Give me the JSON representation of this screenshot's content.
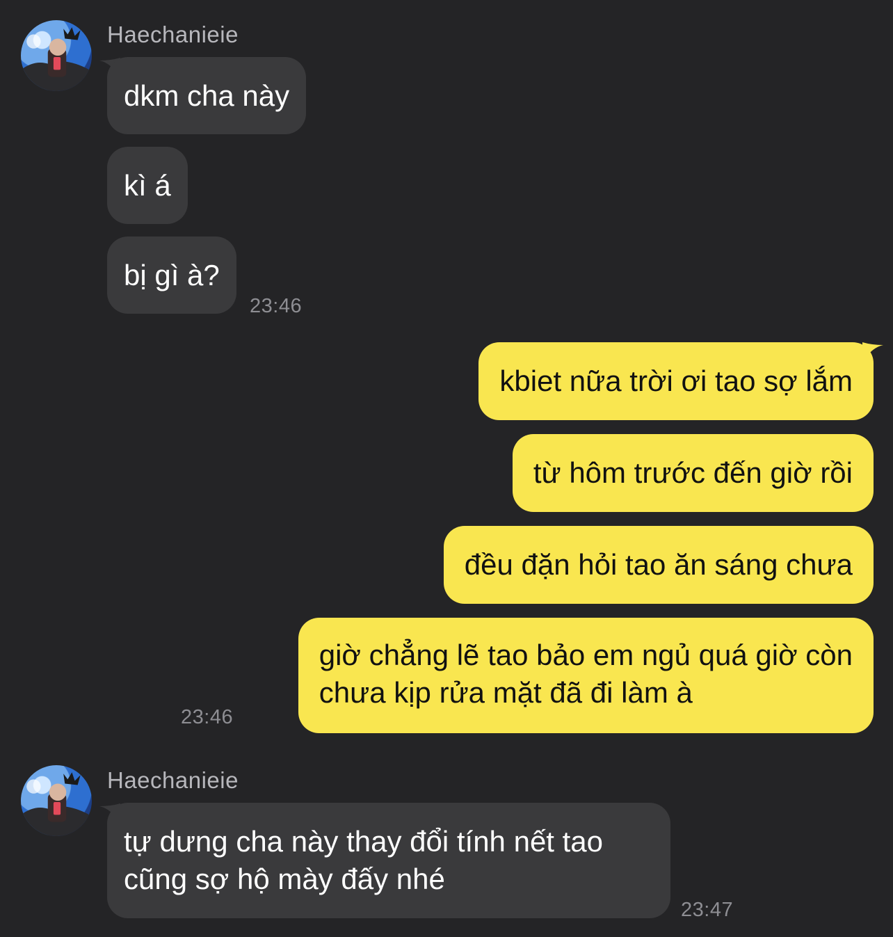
{
  "chat": {
    "sender_name": "Haechanieie",
    "colors": {
      "background": "#242426",
      "incoming_bubble": "#3a3a3c",
      "outgoing_bubble": "#f9e650",
      "timestamp": "#8e8e93"
    },
    "group1": {
      "messages": [
        "dkm cha này",
        "kì á",
        "bị gì à?"
      ],
      "time": "23:46"
    },
    "group2": {
      "messages": [
        "kbiet nữa trời ơi tao sợ lắm",
        "từ hôm trước đến giờ rồi",
        "đều đặn hỏi tao ăn sáng chưa",
        "giờ chẳng lẽ tao bảo em ngủ quá giờ còn\nchưa kịp rửa mặt đã đi làm à"
      ],
      "time": "23:46"
    },
    "group3": {
      "messages": [
        "tự dưng cha này thay đổi tính nết tao\ncũng sợ hộ mày đấy nhé"
      ],
      "time": "23:47"
    }
  }
}
